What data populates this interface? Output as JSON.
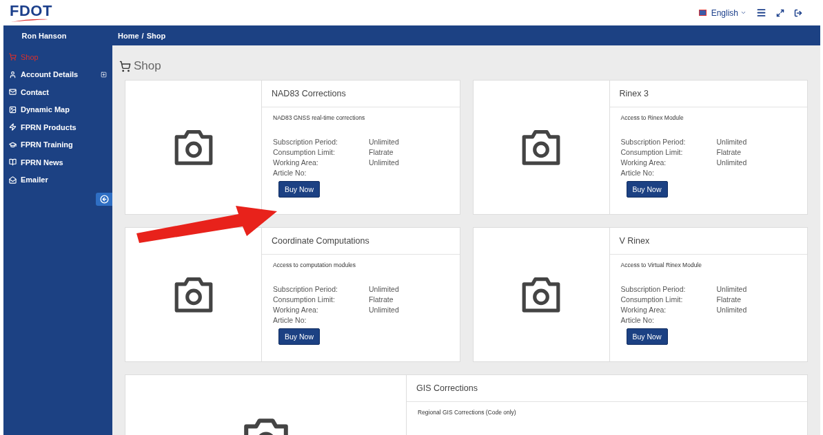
{
  "header": {
    "logo": "FDOT",
    "language": "English"
  },
  "topbar": {
    "user": "Ron Hanson",
    "breadcrumb": [
      "Home",
      "Shop"
    ],
    "separator": "/"
  },
  "sidebar": {
    "items": [
      {
        "label": "Shop",
        "selected": true,
        "expandable": false
      },
      {
        "label": "Account Details",
        "selected": false,
        "expandable": true
      },
      {
        "label": "Contact",
        "selected": false,
        "expandable": false
      },
      {
        "label": "Dynamic Map",
        "selected": false,
        "expandable": false
      },
      {
        "label": "FPRN Products",
        "selected": false,
        "expandable": false
      },
      {
        "label": "FPRN Training",
        "selected": false,
        "expandable": false
      },
      {
        "label": "FPRN News",
        "selected": false,
        "expandable": false
      },
      {
        "label": "Emailer",
        "selected": false,
        "expandable": false
      }
    ]
  },
  "page": {
    "title": "Shop"
  },
  "products": [
    {
      "kind": "half",
      "title": "NAD83 Corrections",
      "description": "NAD83 GNSS real-time corrections",
      "fields": [
        {
          "label": "Subscription Period:",
          "value": "Unlimited"
        },
        {
          "label": "Consumption Limit:",
          "value": "Flatrate"
        },
        {
          "label": "Working Area:",
          "value": "Unlimited"
        },
        {
          "label": "Article No:"
        }
      ],
      "button": "Buy Now"
    },
    {
      "kind": "half",
      "title": "Rinex 3",
      "description": "Access to Rinex Module",
      "fields": [
        {
          "label": "Subscription Period:",
          "value": "Unlimited"
        },
        {
          "label": "Consumption Limit:",
          "value": "Flatrate"
        },
        {
          "label": "Working Area:",
          "value": "Unlimited"
        },
        {
          "label": "Article No:"
        }
      ],
      "button": "Buy Now"
    },
    {
      "kind": "half",
      "title": "Coordinate Computations",
      "description": "Access to computation modules",
      "fields": [
        {
          "label": "Subscription Period:",
          "value": "Unlimited"
        },
        {
          "label": "Consumption Limit:",
          "value": "Flatrate"
        },
        {
          "label": "Working Area:",
          "value": "Unlimited"
        },
        {
          "label": "Article No:"
        }
      ],
      "button": "Buy Now"
    },
    {
      "kind": "half",
      "title": "V Rinex",
      "description": "Access to Virtual Rinex Module",
      "fields": [
        {
          "label": "Subscription Period:",
          "value": "Unlimited"
        },
        {
          "label": "Consumption Limit:",
          "value": "Flatrate"
        },
        {
          "label": "Working Area:",
          "value": "Unlimited"
        },
        {
          "label": "Article No:"
        }
      ],
      "button": "Buy Now"
    },
    {
      "kind": "wide",
      "title": "GIS Corrections",
      "description": "Regional GIS Corrections (Code only)"
    }
  ]
}
